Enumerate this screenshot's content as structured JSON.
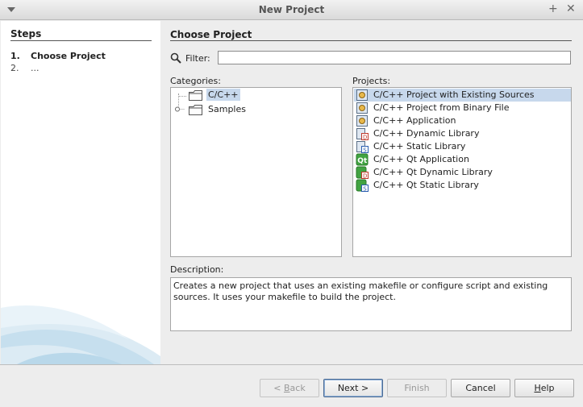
{
  "window": {
    "title": "New Project",
    "pin_glyph": "+",
    "close_glyph": "✕"
  },
  "steps": {
    "title": "Steps",
    "items": [
      {
        "num": "1.",
        "label": "Choose Project"
      },
      {
        "num": "2.",
        "label": "..."
      }
    ]
  },
  "main": {
    "title": "Choose Project",
    "filter": {
      "label": "Filter:",
      "value": ""
    },
    "categories": {
      "label": "Categories:",
      "items": [
        {
          "label": "C/C++",
          "selected": true
        },
        {
          "label": "Samples",
          "selected": false
        }
      ]
    },
    "projects": {
      "label": "Projects:",
      "items": [
        {
          "label": "C/C++ Project with Existing Sources",
          "icon": "existing-sources-icon",
          "selected": true
        },
        {
          "label": "C/C++ Project from Binary File",
          "icon": "binary-file-icon"
        },
        {
          "label": "C/C++ Application",
          "icon": "application-icon"
        },
        {
          "label": "C/C++ Dynamic Library",
          "icon": "dynamic-library-icon"
        },
        {
          "label": "C/C++ Static Library",
          "icon": "static-library-icon"
        },
        {
          "label": "C/C++ Qt Application",
          "icon": "qt-application-icon"
        },
        {
          "label": "C/C++ Qt Dynamic Library",
          "icon": "qt-dynamic-library-icon"
        },
        {
          "label": "C/C++ Qt Static Library",
          "icon": "qt-static-library-icon"
        }
      ]
    },
    "description": {
      "label": "Description:",
      "text": "Creates a new project that uses an existing makefile or configure script and existing sources. It uses your makefile to build the project."
    }
  },
  "buttons": {
    "back": {
      "prefix": "< ",
      "mnemonic": "B",
      "rest": "ack",
      "enabled": false
    },
    "next": {
      "label": "Next >",
      "enabled": true
    },
    "finish": {
      "label": "Finish",
      "enabled": false
    },
    "cancel": {
      "label": "Cancel",
      "enabled": true
    },
    "help": {
      "mnemonic": "H",
      "rest": "elp",
      "enabled": true
    }
  },
  "colors": {
    "selection": "#c7d8ec",
    "qt_green": "#41a341"
  }
}
